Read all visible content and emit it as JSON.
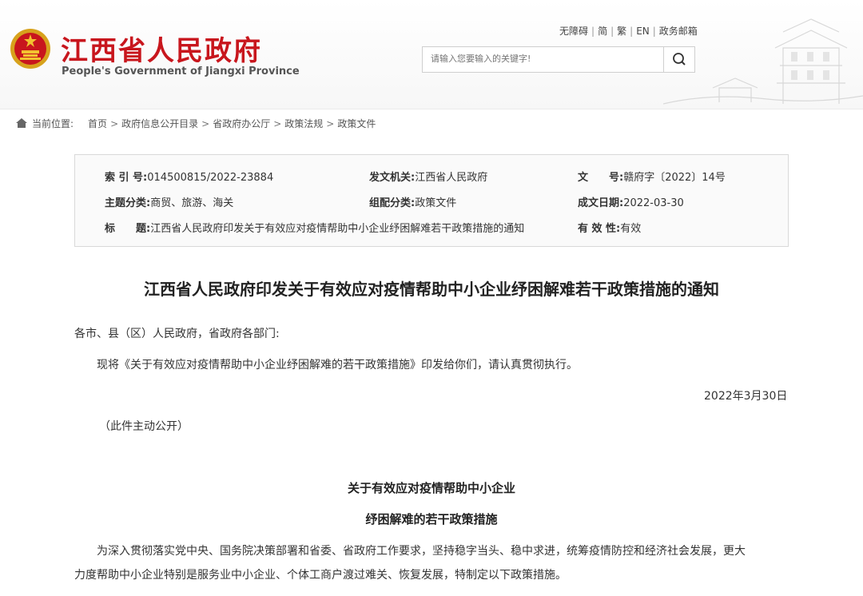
{
  "header": {
    "site_title": "江西省人民政府",
    "site_subtitle": "People's Government of Jiangxi Province",
    "top_links": [
      "无障碍",
      "简",
      "繁",
      "EN",
      "政务邮箱"
    ],
    "search_placeholder": "请输入您要输入的关键字!",
    "colors": {
      "brand_red": "#c8161d"
    }
  },
  "breadcrumb": {
    "label": "当前位置:",
    "items": [
      "首页",
      "政府信息公开目录",
      "省政府办公厅",
      "政策法规",
      "政策文件"
    ]
  },
  "info": {
    "index_label": "索 引 号:",
    "index_value": "014500815/2022-23884",
    "issuer_label": "发文机关:",
    "issuer_value": "江西省人民政府",
    "docno_label": "文　　号:",
    "docno_value": "赣府字〔2022〕14号",
    "topic_label": "主题分类:",
    "topic_value": "商贸、旅游、海关",
    "category_label": "组配分类:",
    "category_value": "政策文件",
    "date_label": "成文日期:",
    "date_value": "2022-03-30",
    "title_label": "标　　题:",
    "title_value": "江西省人民政府印发关于有效应对疫情帮助中小企业纾困解难若干政策措施的通知",
    "validity_label": "有 效 性:",
    "validity_value": "有效"
  },
  "article": {
    "title": "江西省人民政府印发关于有效应对疫情帮助中小企业纾困解难若干政策措施的通知",
    "salutation": "各市、县（区）人民政府，省政府各部门:",
    "body1": "现将《关于有效应对疫情帮助中小企业纾困解难的若干政策措施》印发给你们，请认真贯彻执行。",
    "date": "2022年3月30日",
    "note": "（此件主动公开）",
    "subtitle1": "关于有效应对疫情帮助中小企业",
    "subtitle2": "纾困解难的若干政策措施",
    "para_line1": "为深入贯彻落实党中央、国务院决策部署和省委、省政府工作要求，坚持稳字当头、稳中求进，统筹疫情防控和经济社会发展，更大",
    "para_line2": "力度帮助中小企业特别是服务业中小企业、个体工商户渡过难关、恢复发展，特制定以下政策措施。"
  }
}
